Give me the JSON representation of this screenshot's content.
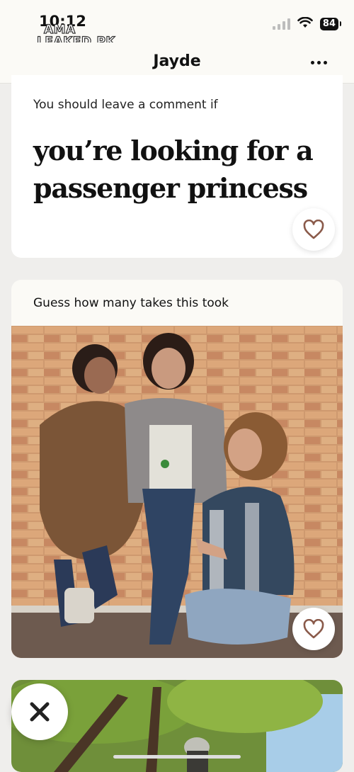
{
  "status": {
    "time": "10:12",
    "battery": "84",
    "watermark_line1": "AMA",
    "watermark_line2": "LEAKED.PK"
  },
  "header": {
    "title": "Jayde"
  },
  "prompt": {
    "question": "You should leave a comment if",
    "answer": "you’re looking for a passenger princess"
  },
  "photo_card": {
    "caption": "Guess how many takes this took"
  },
  "colors": {
    "accent_heart": "#8a5a4a",
    "background": "#efeeec",
    "header_bg": "#fbfaf6"
  },
  "icons": {
    "like": "heart-icon",
    "pass": "x-icon",
    "more": "more-dots-icon"
  }
}
